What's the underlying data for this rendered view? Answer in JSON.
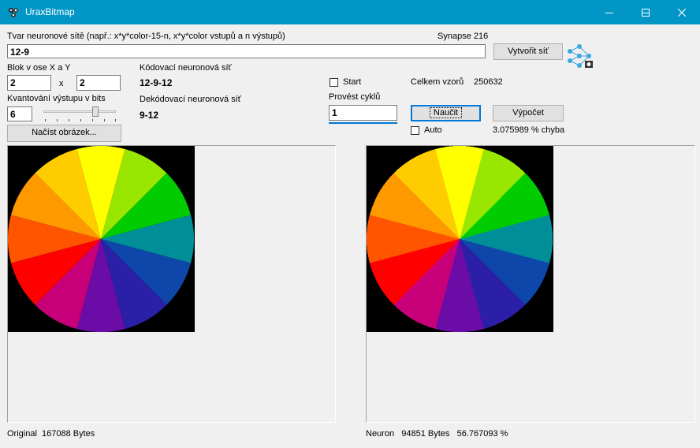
{
  "window": {
    "title": "UraxBitmap",
    "minimize_label": "–",
    "maximize_label": "☐",
    "close_label": "✕"
  },
  "network": {
    "shape_label": "Tvar neuronové sítě (např.: x*y*color-15-n, x*y*color vstupů a n výstupů)",
    "shape_value": "12-9",
    "synapse_label": "Synapse 216",
    "create_button": "Vytvořit síť",
    "icon": "neural-network-icon"
  },
  "block": {
    "label": "Blok v ose X a Y",
    "x_value": "2",
    "separator": "x",
    "y_value": "2"
  },
  "coding": {
    "encoder_label": "Kódovací neuronová síť",
    "encoder_value": "12-9-12",
    "decoder_label": "Dekódovací neuronová síť",
    "decoder_value": "9-12"
  },
  "quantization": {
    "label": "Kvantování výstupu v bits",
    "value": "6",
    "slider_fraction": 0.75
  },
  "load_button": "Načíst obrázek...",
  "training": {
    "start_label": "Start",
    "start_checked": false,
    "cycles_label": "Provést cyklů",
    "cycles_value": "1",
    "learn_button": "Naučit",
    "auto_label": "Auto",
    "auto_checked": false,
    "total_patterns_label": "Celkem vzorů",
    "total_patterns_value": "250632",
    "compute_button": "Výpočet",
    "error_text": "3.075989 % chyba"
  },
  "status": {
    "original_label": "Original",
    "original_bytes": "167088 Bytes",
    "neuron_label": "Neuron",
    "neuron_bytes": "94851 Bytes",
    "neuron_percent": "56.767093 %"
  },
  "color_wheel": {
    "segments": [
      "#ffff00",
      "#99e600",
      "#00cc00",
      "#008f99",
      "#0e47a9",
      "#2a1fa6",
      "#6c0ca6",
      "#c7007a",
      "#ff0000",
      "#ff5500",
      "#ff9900",
      "#ffcc00"
    ]
  }
}
